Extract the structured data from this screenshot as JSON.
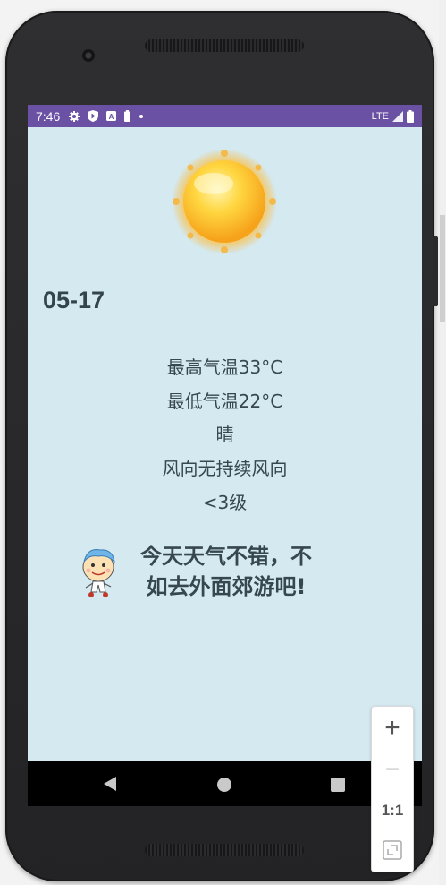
{
  "status_bar": {
    "time": "7:46",
    "left_icons": [
      "gear-icon",
      "play-protect-icon",
      "a-badge-icon",
      "battery-small-icon",
      "dot-icon"
    ],
    "network": "LTE",
    "background": "#6a51a3"
  },
  "weather": {
    "icon": "sun-icon",
    "date": "05-17",
    "high": "最高气温33°C",
    "low": "最低气温22°C",
    "condition": "晴",
    "wind_direction": "风向无持续风向",
    "wind_level": "<3级",
    "message": "今天天气不错，不如去外面郊游吧!"
  },
  "zoom_controls": {
    "zoom_in": "+",
    "zoom_out": "−",
    "actual_size": "1:1"
  },
  "colors": {
    "screen_background": "#d5e9f0",
    "text": "#37474f"
  }
}
